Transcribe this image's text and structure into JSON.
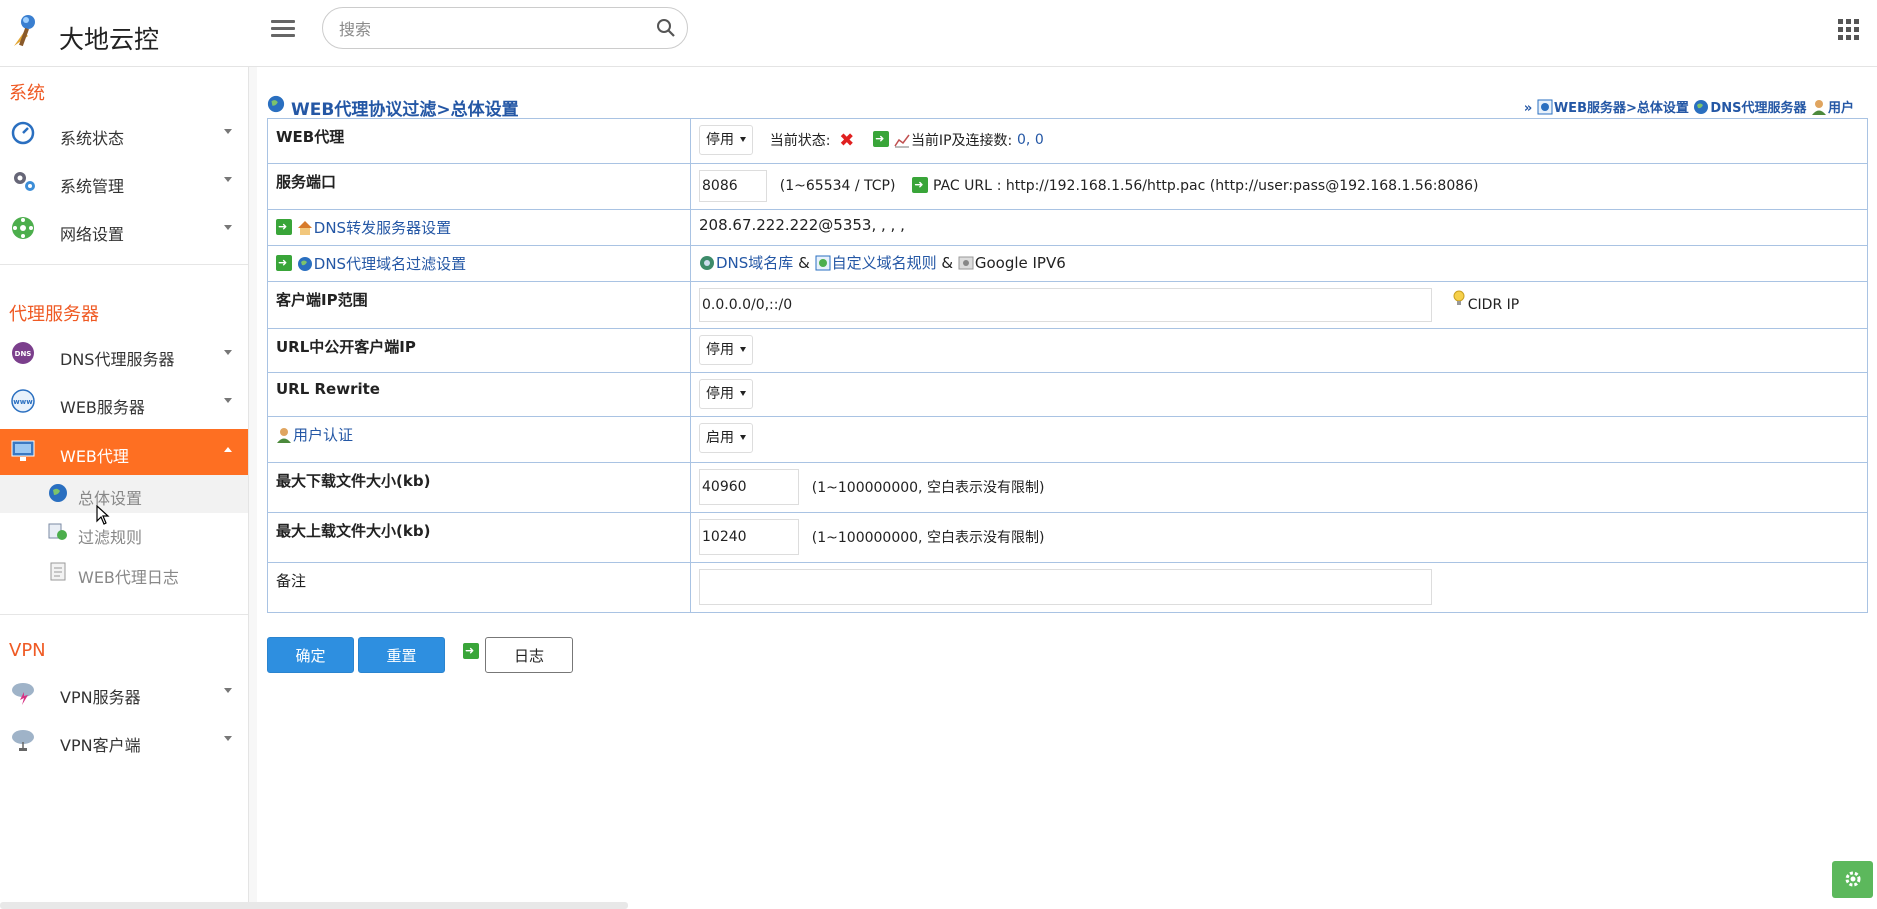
{
  "app": {
    "brand": "大地云控",
    "search_placeholder": "搜索"
  },
  "sidebar": {
    "sections": [
      {
        "title": "系统"
      },
      {
        "title": "代理服务器"
      },
      {
        "title": "VPN"
      }
    ],
    "items": [
      {
        "label": "系统状态",
        "icon": "speedometer-icon"
      },
      {
        "label": "系统管理",
        "icon": "gears-icon"
      },
      {
        "label": "网络设置",
        "icon": "network-icon"
      },
      {
        "label": "DNS代理服务器",
        "icon": "dns-icon"
      },
      {
        "label": "WEB服务器",
        "icon": "www-globe-icon"
      },
      {
        "label": "WEB代理",
        "icon": "monitor-icon",
        "active": true
      },
      {
        "label": "VPN服务器",
        "icon": "cloud-lightning-icon"
      },
      {
        "label": "VPN客户端",
        "icon": "cloud-network-icon"
      }
    ],
    "subitems": [
      {
        "label": "总体设置",
        "icon": "globe-icon",
        "current": true
      },
      {
        "label": "过滤规则",
        "icon": "filter-rules-icon"
      },
      {
        "label": "WEB代理日志",
        "icon": "log-icon"
      }
    ]
  },
  "page": {
    "title": "WEB代理协议过滤>总体设置",
    "breadcrumb": {
      "prefix": "»",
      "links": [
        "WEB服务器>总体设置",
        "DNS代理服务器",
        "用户"
      ]
    }
  },
  "form": {
    "web_proxy": {
      "label": "WEB代理",
      "value": "停用",
      "status_label": "当前状态:",
      "ip_conn_label": "当前IP及连接数:",
      "ip_conn_value": "0, 0"
    },
    "service_port": {
      "label": "服务端口",
      "value": "8086",
      "range_note": "(1~65534 / TCP)",
      "pac_label": "PAC URL",
      "pac_value": ": http://192.168.1.56/http.pac (http://user:pass@192.168.1.56:8086)"
    },
    "dns_forward": {
      "label": "DNS转发服务器设置",
      "value": "208.67.222.222@5353, , , ,"
    },
    "dns_filter": {
      "label": "DNS代理域名过滤设置",
      "link1": "DNS域名库",
      "amp": "&",
      "link2": "自定义域名规则",
      "extra": "Google IPV6"
    },
    "client_ip": {
      "label": "客户端IP范围",
      "value": "0.0.0.0/0,::/0",
      "hint": "CIDR IP"
    },
    "url_public_ip": {
      "label": "URL中公开客户端IP",
      "value": "停用"
    },
    "url_rewrite": {
      "label": "URL Rewrite",
      "value": "停用"
    },
    "user_auth": {
      "label": "用户认证",
      "value": "启用"
    },
    "max_download": {
      "label": "最大下载文件大小(kb)",
      "value": "40960",
      "note": "(1~100000000, 空白表示没有限制)"
    },
    "max_upload": {
      "label": "最大上载文件大小(kb)",
      "value": "10240",
      "note": "(1~100000000, 空白表示没有限制)"
    },
    "remark": {
      "label": "备注",
      "value": ""
    }
  },
  "buttons": {
    "confirm": "确定",
    "reset": "重置",
    "log": "日志"
  },
  "colors": {
    "accent_orange": "#fe6f22",
    "section_orange": "#ef5a24",
    "link_blue": "#2457a5",
    "button_blue": "#2e8fe0",
    "table_border": "#a9c3e3",
    "fab_green": "#5cb85c"
  }
}
